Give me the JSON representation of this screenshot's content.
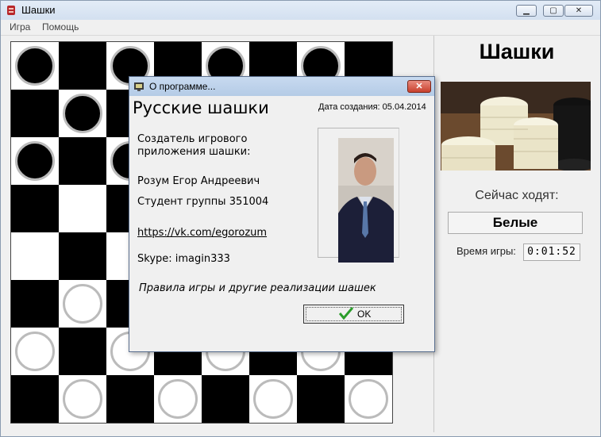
{
  "window": {
    "title": "Шашки"
  },
  "menu": {
    "items": [
      "Игра",
      "Помощь"
    ]
  },
  "board": {
    "size": 8,
    "pieces": [
      {
        "row": 0,
        "col": 0,
        "color": "black"
      },
      {
        "row": 0,
        "col": 2,
        "color": "black"
      },
      {
        "row": 0,
        "col": 4,
        "color": "black"
      },
      {
        "row": 0,
        "col": 6,
        "color": "black"
      },
      {
        "row": 1,
        "col": 1,
        "color": "black"
      },
      {
        "row": 2,
        "col": 0,
        "color": "black"
      },
      {
        "row": 2,
        "col": 2,
        "color": "black"
      },
      {
        "row": 5,
        "col": 1,
        "color": "white"
      },
      {
        "row": 6,
        "col": 0,
        "color": "white"
      },
      {
        "row": 6,
        "col": 2,
        "color": "white"
      },
      {
        "row": 6,
        "col": 4,
        "color": "white"
      },
      {
        "row": 6,
        "col": 6,
        "color": "white"
      },
      {
        "row": 7,
        "col": 1,
        "color": "white"
      },
      {
        "row": 7,
        "col": 3,
        "color": "white"
      },
      {
        "row": 7,
        "col": 5,
        "color": "white"
      },
      {
        "row": 7,
        "col": 7,
        "color": "white"
      }
    ]
  },
  "side": {
    "title": "Шашки",
    "turn_label": "Сейчас ходят:",
    "turn_value": "Белые",
    "time_label": "Время игры:",
    "time_value": "0:01:52"
  },
  "dialog": {
    "title": "О программе...",
    "heading": "Русские шашки",
    "date": "Дата создания: 05.04.2014",
    "creator_line1": "Создатель игрового",
    "creator_line2": "приложения шашки:",
    "author": "Розум Егор Андреевич",
    "group": "Студент группы 351004",
    "link": "https://vk.com/egorozum",
    "skype": "Skype: imagin333",
    "rules": "Правила игры и другие реализации шашек",
    "ok_label": "OK"
  },
  "colors": {
    "dark_square": "#000000",
    "light_square": "#ffffff",
    "ok_check": "#2a9d2a"
  }
}
